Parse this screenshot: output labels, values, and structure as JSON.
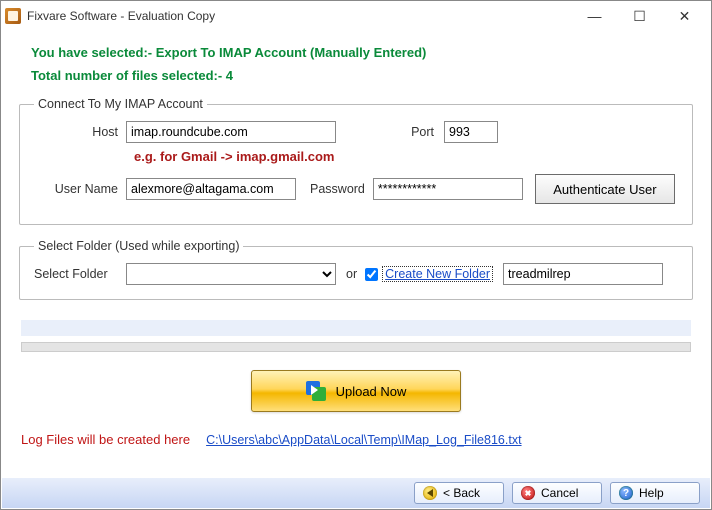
{
  "window": {
    "title": "Fixvare Software - Evaluation Copy"
  },
  "info": {
    "selection": "You have selected:- Export To IMAP Account (Manually Entered)",
    "fileCount": "Total number of files selected:- 4"
  },
  "imap": {
    "legend": "Connect To My IMAP Account",
    "hostLabel": "Host",
    "hostValue": "imap.roundcube.com",
    "portLabel": "Port",
    "portValue": "993",
    "hint": "e.g. for Gmail -> imap.gmail.com",
    "userLabel": "User Name",
    "userValue": "alexmore@altagama.com",
    "passLabel": "Password",
    "passValue": "************",
    "authLabel": "Authenticate User"
  },
  "folder": {
    "legend": "Select Folder (Used while exporting)",
    "selectLabel": "Select Folder",
    "selectedValue": "",
    "orLabel": "or",
    "createLabel": "Create New Folder",
    "createChecked": true,
    "newFolderValue": "treadmilrep"
  },
  "upload": {
    "label": "Upload Now"
  },
  "log": {
    "label": "Log Files will be created here",
    "path": "C:\\Users\\abc\\AppData\\Local\\Temp\\IMap_Log_File816.txt"
  },
  "footer": {
    "back": "< Back",
    "cancel": "Cancel",
    "help": "Help"
  }
}
